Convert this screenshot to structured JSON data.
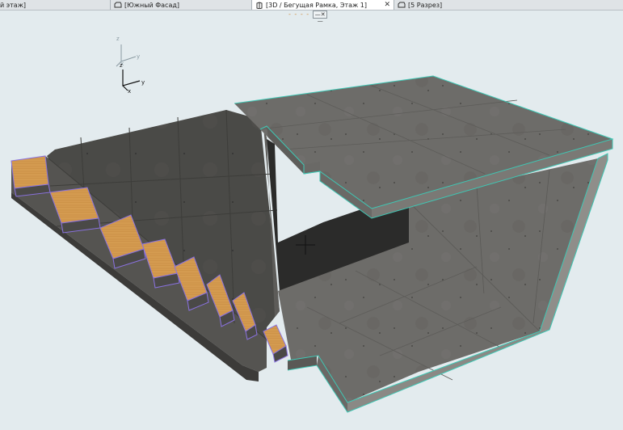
{
  "tabs": [
    {
      "label": "й этаж]",
      "icon": "floor-plan-icon",
      "active": false
    },
    {
      "label": "[Южный Фасад]",
      "icon": "elevation-icon",
      "active": false
    },
    {
      "label": "[3D / Бегущая Рамка, Этаж 1]",
      "icon": "3d-view-icon",
      "active": true,
      "close": "✕"
    },
    {
      "label": "[5 Разрез]",
      "icon": "section-icon",
      "active": false
    }
  ],
  "view_toolbar": {
    "dash_label": "- - - -",
    "button_label": "—✕—"
  },
  "axes": {
    "upper": {
      "z": "z",
      "y": "y",
      "x": "x"
    },
    "lower": {
      "z": "z",
      "y": "y",
      "x": "x"
    }
  },
  "colors": {
    "background": "#e3ebee",
    "concrete": "#6e6d6a",
    "wood": "#d39a4f",
    "edge_highlight": "#3fc7b4",
    "stair_edge": "#8a72e0"
  }
}
